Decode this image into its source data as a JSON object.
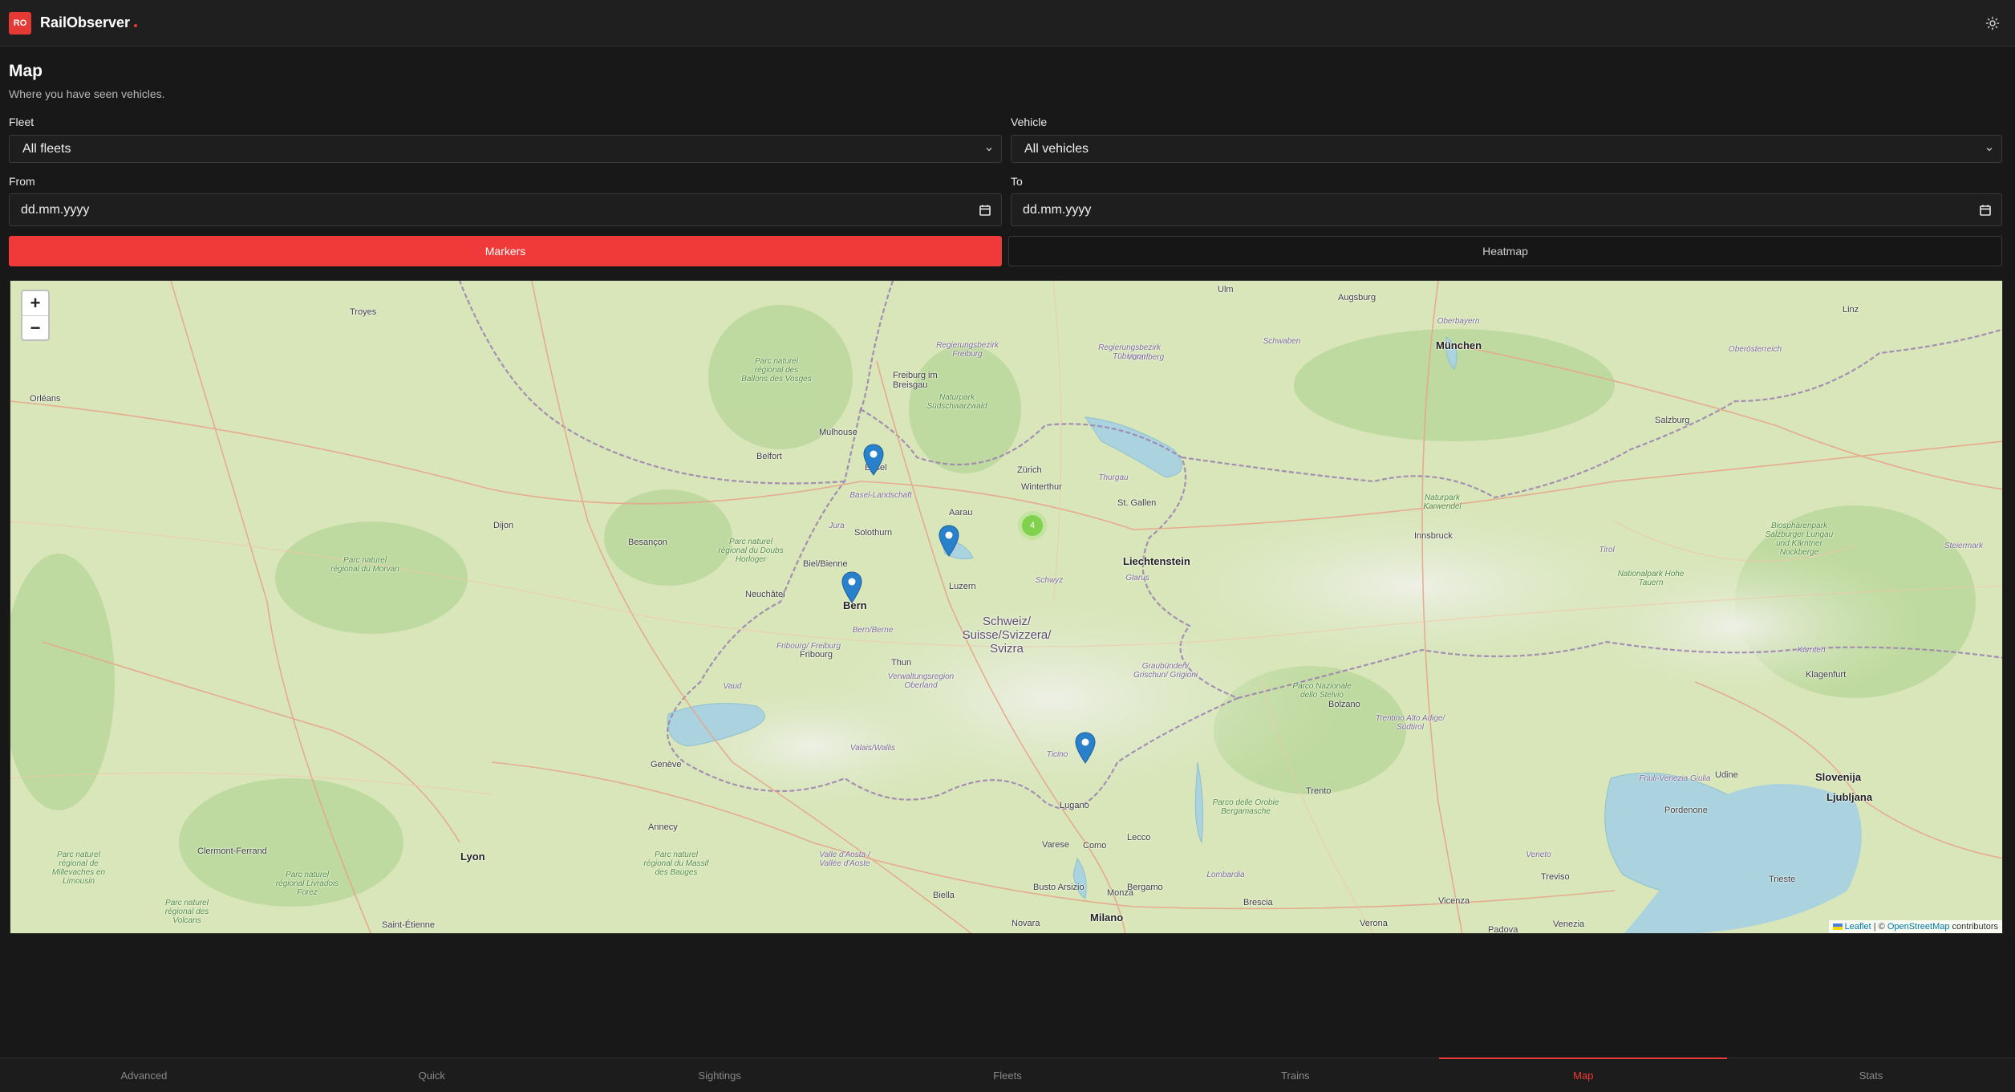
{
  "app": {
    "logo_text": "RO",
    "name": "RailObserver"
  },
  "header": {
    "theme_icon": "sun-icon"
  },
  "page": {
    "title": "Map",
    "subtitle": "Where you have seen vehicles."
  },
  "filters": {
    "fleet": {
      "label": "Fleet",
      "value": "All fleets"
    },
    "vehicle": {
      "label": "Vehicle",
      "value": "All vehicles"
    },
    "from": {
      "label": "From",
      "placeholder": "dd.mm.yyyy"
    },
    "to": {
      "label": "To",
      "placeholder": "dd.mm.yyyy"
    }
  },
  "mode": {
    "markers": "Markers",
    "heatmap": "Heatmap",
    "active": "markers"
  },
  "map": {
    "zoom_in": "+",
    "zoom_out": "−",
    "cluster_count": "4",
    "places": {
      "munchen": "München",
      "bern": "Bern",
      "basel": "Basel",
      "zurich": "Zürich",
      "winterthur": "Winterthur",
      "luzern": "Luzern",
      "st_gallen": "St. Gallen",
      "liechtenstein": "Liechtenstein",
      "schweiz": "Schweiz/ Suisse/Svizzera/ Svizra",
      "innsbruck": "Innsbruck",
      "salzburg": "Salzburg",
      "linz": "Linz",
      "augsburg": "Augsburg",
      "ulm": "Ulm",
      "freiburg": "Freiburg im Breisgau",
      "mulhouse": "Mulhouse",
      "belfort": "Belfort",
      "besancon": "Besançon",
      "dijon": "Dijon",
      "troyes": "Troyes",
      "orleans": "Orléans",
      "geneve": "Genève",
      "lyon": "Lyon",
      "annecy": "Annecy",
      "lugano": "Lugano",
      "milano": "Milano",
      "como": "Como",
      "varese": "Varese",
      "novara": "Novara",
      "biella": "Biella",
      "bergamo": "Bergamo",
      "brescia": "Brescia",
      "verona": "Verona",
      "vicenza": "Vicenza",
      "padova": "Padova",
      "venezia": "Venezia",
      "trento": "Trento",
      "bolzano": "Bolzano",
      "treviso": "Treviso",
      "trieste": "Trieste",
      "ljubljana": "Ljubljana",
      "slovenija": "Slovenija",
      "klagenfurt": "Klagenfurt",
      "pordenone": "Pordenone",
      "udine": "Udine",
      "clermont": "Clermont-Ferrand",
      "saint_etienne": "Saint-Étienne",
      "biel": "Biel/Bienne",
      "solothurn": "Solothurn",
      "aarau": "Aarau",
      "thun": "Thun",
      "fribourg": "Fribourg",
      "lecco": "Lecco",
      "busto": "Busto Arsizio",
      "monza": "Monza",
      "neuchatel": "Neuchâtel",
      "park_morvan": "Parc naturel régional du Morvan",
      "park_vosges": "Parc naturel régional des Ballons des Vosges",
      "park_schwarzwald": "Naturpark Südschwarzwald",
      "park_doubs": "Parc naturel régional du Doubs Horloger",
      "park_volcans": "Parc naturel régional des Volcans",
      "park_livradois": "Parc naturel régional Livradois Forez",
      "park_limousin": "Parc naturel régional de Millevaches en Limousin",
      "park_bauges": "Parc naturel régional du Massif des Bauges",
      "park_karwendel": "Naturpark Karwendel",
      "park_stelvio": "Parco Nazionale dello Stelvio",
      "park_nockberge": "Biosphärenpark Salzburger Lungau und Kärntner Nockberge",
      "park_hohetauern": "Nationalpark Hohe Tauern",
      "park_orobie": "Parco delle Orobie Bergamasche",
      "region_tirol": "Tirol",
      "region_vorarlberg": "Vorarlberg",
      "region_graubunden": "Graubünden/ Grischun/ Grigioni",
      "region_ticino": "Ticino",
      "region_valais": "Valais/Wallis",
      "region_vaud": "Vaud",
      "region_jura": "Jura",
      "region_schwyz": "Schwyz",
      "region_glarus": "Glarus",
      "region_thurgau": "Thurgau",
      "region_lombardia": "Lombardia",
      "region_veneto": "Veneto",
      "region_trentino": "Trentino Alto Adige/ Südtirol",
      "region_friuli": "Friuli-Venezia Giulia",
      "region_karnten": "Kärnten",
      "region_steiermark": "Steiermark",
      "region_aosta": "Valle d'Aosta / Vallée d'Aoste",
      "region_baselland": "Basel-Landschaft",
      "region_bernbe": "Bern/Berne",
      "region_oberland": "Verwaltungsregion Oberland",
      "region_oberbayern": "Oberbayern",
      "region_schwaben": "Schwaben",
      "region_oberosterreich": "Oberösterreich",
      "region_freiburg": "Regierungsbezirk Freiburg",
      "region_tubingen": "Regierungsbezirk Tübingen",
      "region_fribourg": "Fribourg/ Freiburg"
    },
    "attribution": {
      "leaflet": "Leaflet",
      "sep": " | © ",
      "osm": "OpenStreetMap",
      "suffix": " contributors"
    }
  },
  "nav": {
    "advanced": "Advanced",
    "quick": "Quick",
    "sightings": "Sightings",
    "fleets": "Fleets",
    "trains": "Trains",
    "map": "Map",
    "stats": "Stats",
    "active": "map"
  }
}
